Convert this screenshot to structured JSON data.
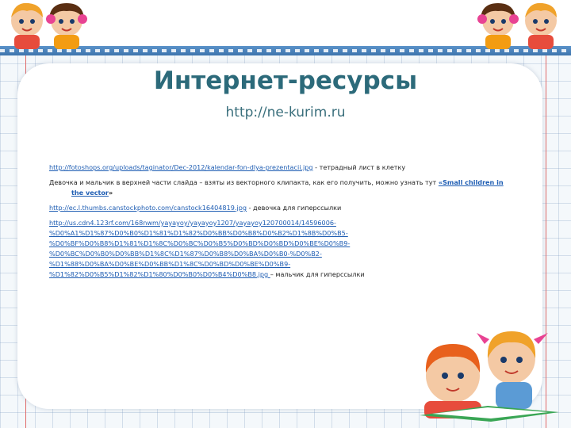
{
  "slide": {
    "title": "Интернет-ресурсы",
    "subtitle": "http://ne-kurim.ru"
  },
  "references": [
    {
      "link": "http://fotoshops.org/uploads/taginator/Dec-2012/kalendar-fon-dlya-prezentacii.jpg",
      "text": " - тетрадный лист в клетку"
    },
    {
      "prefix": "Девочка и мальчик в верхней части слайда – взяты из векторного клипакта, как его получить, можно узнать тут ",
      "link": "«Small children in the vector",
      "suffix": "»"
    },
    {
      "link": "http://ec.l.thumbs.canstockphoto.com/canstock16404819.jpg",
      "text": " - девочка для гиперссылки"
    },
    {
      "link_lines": [
        "http://us.cdn4.123rf.com/168nwm/yayayoy/yayayoy1207/yayayoy120700014/14596006-",
        "%D0%A1%D1%87%D0%B0%D1%81%D1%82%D0%BB%D0%B8%D0%B2%D1%8B%D0%B5-",
        "%D0%BF%D0%B8%D1%81%D1%8C%D0%BC%D0%B5%D0%BD%D0%BD%D0%BE%D0%B9-",
        "%D0%BC%D0%B0%D0%BB%D1%8C%D1%87%D0%B8%D0%BA%D0%B0-%D0%B2-",
        "%D1%88%D0%BA%D0%BE%D0%BB%D1%8C%D0%BD%D0%BE%D0%B9-",
        "%D1%82%D0%B5%D1%82%D1%80%D0%B0%D0%B4%D0%B8.jpg "
      ],
      "text": "– мальчик для гиперссылки"
    }
  ],
  "colors": {
    "title": "#2c6a7a",
    "link": "#1e5db3",
    "bar": "#3d74ad",
    "card": "#ffffff"
  }
}
